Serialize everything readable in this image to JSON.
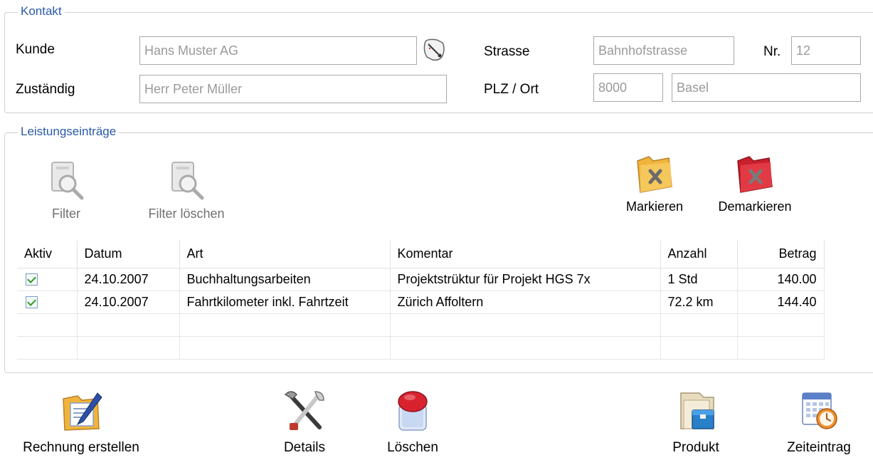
{
  "kontakt": {
    "legend": "Kontakt",
    "kunde_label": "Kunde",
    "kunde_value": "Hans Muster AG",
    "zustaendig_label": "Zuständig",
    "zustaendig_value": "Herr Peter Müller",
    "strasse_label": "Strasse",
    "strasse_value": "Bahnhofstrasse",
    "nr_label": "Nr.",
    "nr_value": "12",
    "plz_ort_label": "PLZ / Ort",
    "plz_value": "8000",
    "ort_value": "Basel"
  },
  "leistung": {
    "legend": "Leistungseinträge",
    "toolbar": {
      "filter": "Filter",
      "filter_loeschen": "Filter löschen",
      "markieren": "Markieren",
      "demarkieren": "Demarkieren"
    },
    "columns": [
      "Aktiv",
      "Datum",
      "Art",
      "Komentar",
      "Anzahl",
      "Betrag"
    ],
    "rows": [
      {
        "aktiv": true,
        "datum": "24.10.2007",
        "art": "Buchhaltungsarbeiten",
        "komentar": "Projektstrüktur für Projekt HGS 7x",
        "anzahl": "1 Std",
        "betrag": "140.00"
      },
      {
        "aktiv": true,
        "datum": "24.10.2007",
        "art": "Fahrtkilometer inkl. Fahrtzeit",
        "komentar": "Zürich Affoltern",
        "anzahl": "72.2 km",
        "betrag": "144.40"
      }
    ]
  },
  "actions": {
    "rechnung": "Rechnung erstellen",
    "details": "Details",
    "loeschen": "Löschen",
    "produkt": "Produkt",
    "zeiteintrag": "Zeiteintrag"
  },
  "colors": {
    "legend": "#2a5aa6",
    "field_text": "#9a9a9a"
  }
}
